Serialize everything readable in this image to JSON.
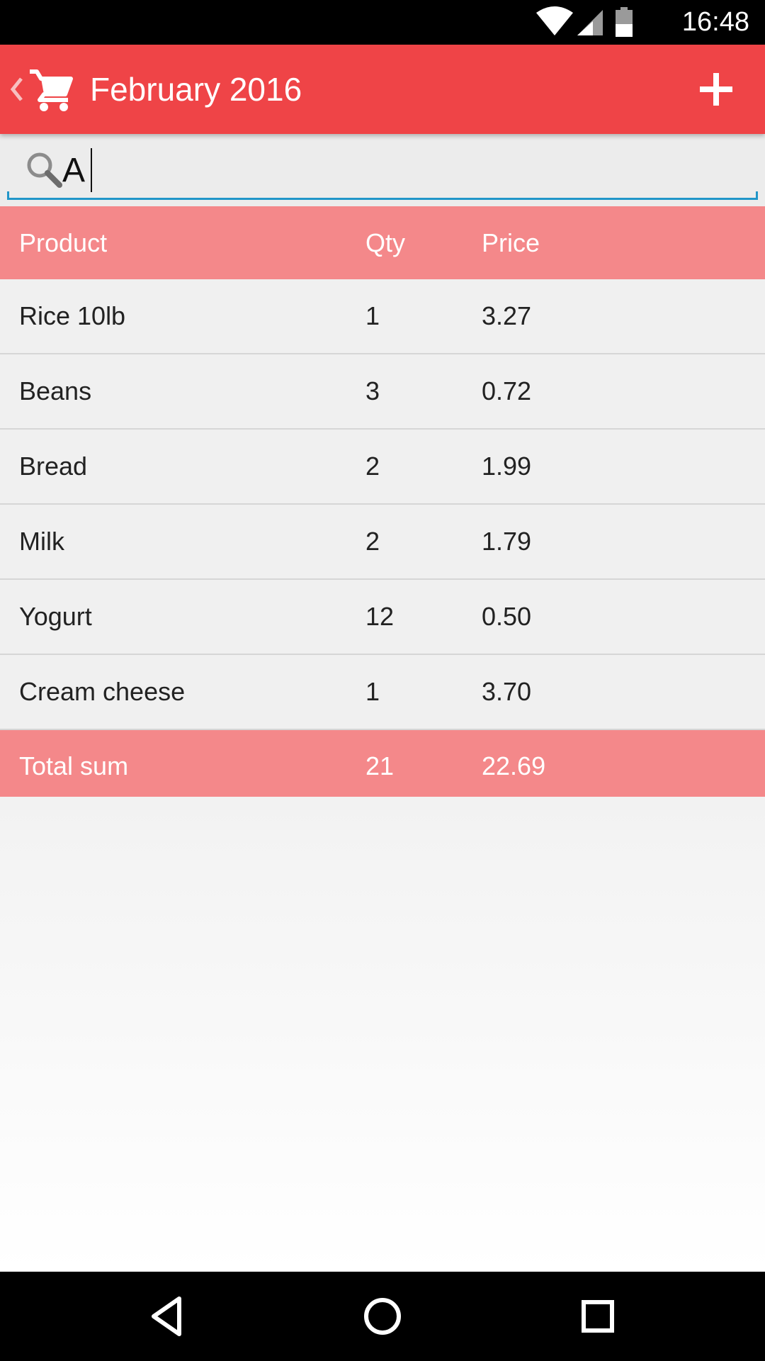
{
  "status_bar": {
    "time": "16:48"
  },
  "app_bar": {
    "title": "February 2016"
  },
  "search": {
    "value": "A"
  },
  "table": {
    "headers": [
      "Product",
      "Qty",
      "Price"
    ],
    "rows": [
      [
        "Rice 10lb",
        "1",
        "3.27"
      ],
      [
        "Beans",
        "3",
        "0.72"
      ],
      [
        "Bread",
        "2",
        "1.99"
      ],
      [
        "Milk",
        "2",
        "1.79"
      ],
      [
        "Yogurt",
        "12",
        "0.50"
      ],
      [
        "Cream cheese",
        "1",
        "3.70"
      ]
    ],
    "total": [
      "Total sum",
      "21",
      "22.69"
    ]
  },
  "icons": {
    "status": [
      "wifi-icon",
      "signal-icon",
      "battery-icon"
    ],
    "app_bar": [
      "back-chevron-icon",
      "cart-icon",
      "plus-icon"
    ],
    "search": "search-icon",
    "nav": [
      "back-icon",
      "home-icon",
      "recents-icon"
    ]
  },
  "colors": {
    "app_bar": "#ef4447",
    "table_header": "#f4888a",
    "search_underline": "#2196c9"
  }
}
